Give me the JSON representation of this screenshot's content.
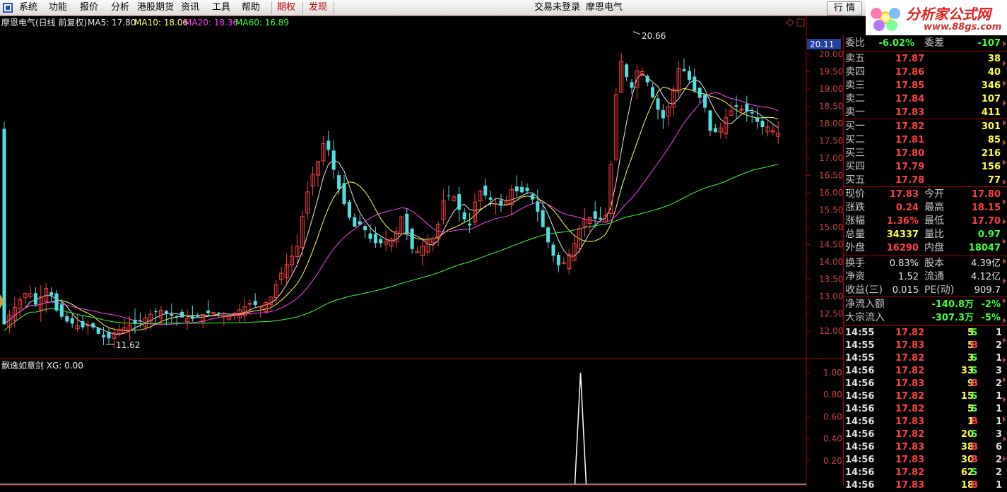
{
  "menu": {
    "items": [
      "系统",
      "功能",
      "报价",
      "分析",
      "港股期货",
      "资讯",
      "工具",
      "帮助"
    ],
    "highlight": [
      "期权",
      "发现"
    ],
    "status": "交易未登录",
    "stock_name": "摩恩电气",
    "quote_button": "行 情"
  },
  "logo": {
    "title": "分析家公式网",
    "url": "www.88gs.com"
  },
  "main_chart": {
    "title": "摩恩电气(日线 前复权)",
    "ma_labels": [
      {
        "text": "MA5: 17.80",
        "color": "#e8e8e8"
      },
      {
        "text": "MA10: 18.06",
        "color": "#ffff60"
      },
      {
        "text": "MA20: 18.36",
        "color": "#ff40ff"
      },
      {
        "text": "MA60: 16.89",
        "color": "#40ff40"
      }
    ],
    "price_ticks": [
      "20.00",
      "19.50",
      "19.00",
      "18.50",
      "18.00",
      "17.50",
      "17.00",
      "16.50",
      "16.00",
      "15.50",
      "15.00",
      "14.50",
      "14.00",
      "13.50",
      "13.00",
      "12.50",
      "12.00"
    ],
    "current_tag": "20.11",
    "high_label": "20.66",
    "low_label": "11.62"
  },
  "indicator": {
    "title": "飘逸如意剑 XG: 0.00",
    "ticks": [
      "1.00",
      "0.80",
      "0.60",
      "0.40",
      "0.20"
    ]
  },
  "chart_data": {
    "type": "candlestick",
    "yrange": [
      11.5,
      20.8
    ],
    "candles": [],
    "indicator_values": {
      "spike_at_index": 0.72,
      "value": 1.0
    }
  },
  "panel": {
    "webi": {
      "label": "委比",
      "value": "-6.02%",
      "label2": "委差",
      "value2": "-107"
    },
    "asks": [
      {
        "label": "卖五",
        "price": "17.87",
        "vol": "38"
      },
      {
        "label": "卖四",
        "price": "17.86",
        "vol": "40"
      },
      {
        "label": "卖三",
        "price": "17.85",
        "vol": "346"
      },
      {
        "label": "卖二",
        "price": "17.84",
        "vol": "107"
      },
      {
        "label": "卖一",
        "price": "17.83",
        "vol": "411"
      }
    ],
    "bids": [
      {
        "label": "买一",
        "price": "17.82",
        "vol": "301"
      },
      {
        "label": "买二",
        "price": "17.81",
        "vol": "85"
      },
      {
        "label": "买三",
        "price": "17.80",
        "vol": "216"
      },
      {
        "label": "买四",
        "price": "17.79",
        "vol": "156"
      },
      {
        "label": "买五",
        "price": "17.78",
        "vol": "77"
      }
    ],
    "stats": [
      {
        "l1": "现价",
        "v1": "17.83",
        "c1": "red",
        "l2": "今开",
        "v2": "17.80",
        "c2": "red"
      },
      {
        "l1": "涨跌",
        "v1": "0.24",
        "c1": "red",
        "l2": "最高",
        "v2": "18.15",
        "c2": "red"
      },
      {
        "l1": "涨幅",
        "v1": "1.36%",
        "c1": "red",
        "l2": "最低",
        "v2": "17.70",
        "c2": "red"
      },
      {
        "l1": "总量",
        "v1": "34337",
        "c1": "yellow",
        "l2": "量比",
        "v2": "0.97",
        "c2": "green"
      },
      {
        "l1": "外盘",
        "v1": "16290",
        "c1": "red",
        "l2": "内盘",
        "v2": "18047",
        "c2": "green"
      }
    ],
    "stats2": [
      {
        "l1": "换手",
        "v1": "0.83%",
        "l2": "股本",
        "v2": "4.39亿"
      },
      {
        "l1": "净资",
        "v1": "1.52",
        "l2": "流通",
        "v2": "4.12亿"
      },
      {
        "l1": "收益(三)",
        "v1": "0.015",
        "l2": "PE(动)",
        "v2": "909.7"
      }
    ],
    "flows": [
      {
        "label": "净流入额",
        "value": "-140.8万",
        "pct": "-2%"
      },
      {
        "label": "大宗流入",
        "value": "-307.3万",
        "pct": "-5%"
      }
    ],
    "ticks": [
      {
        "time": "14:55",
        "price": "17.82",
        "vol": "5",
        "side": "S",
        "cnt": "1"
      },
      {
        "time": "14:55",
        "price": "17.83",
        "vol": "5",
        "side": "B",
        "cnt": "2"
      },
      {
        "time": "14:55",
        "price": "17.82",
        "vol": "3",
        "side": "S",
        "cnt": "1"
      },
      {
        "time": "14:56",
        "price": "17.82",
        "vol": "33",
        "side": "S",
        "cnt": "3"
      },
      {
        "time": "14:56",
        "price": "17.83",
        "vol": "9",
        "side": "B",
        "cnt": "2"
      },
      {
        "time": "14:56",
        "price": "17.82",
        "vol": "15",
        "side": "S",
        "cnt": "1"
      },
      {
        "time": "14:56",
        "price": "17.82",
        "vol": "5",
        "side": "S",
        "cnt": "1"
      },
      {
        "time": "14:56",
        "price": "17.83",
        "vol": "1",
        "side": "B",
        "cnt": "1"
      },
      {
        "time": "14:56",
        "price": "17.82",
        "vol": "20",
        "side": "S",
        "cnt": "3"
      },
      {
        "time": "14:56",
        "price": "17.83",
        "vol": "38",
        "side": "B",
        "cnt": "6"
      },
      {
        "time": "14:56",
        "price": "17.83",
        "vol": "30",
        "side": "B",
        "cnt": "2"
      },
      {
        "time": "14:56",
        "price": "17.82",
        "vol": "62",
        "side": "S",
        "cnt": "2"
      },
      {
        "time": "14:56",
        "price": "17.83",
        "vol": "18",
        "side": "B",
        "cnt": "1"
      }
    ]
  }
}
